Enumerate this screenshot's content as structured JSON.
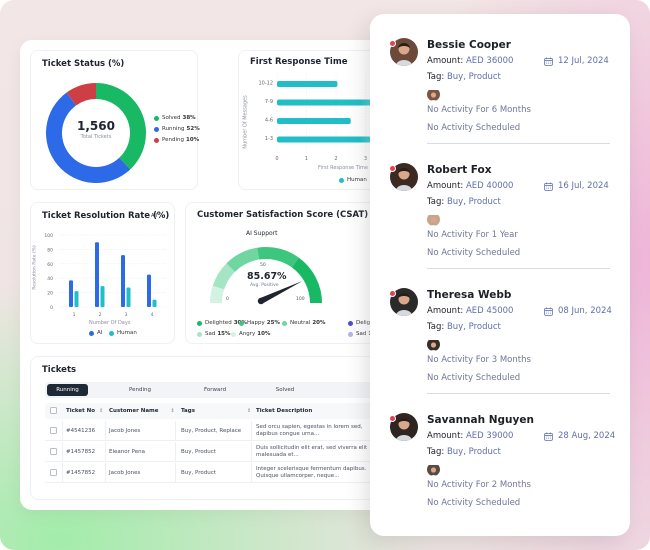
{
  "dashboard": {
    "ticket_status": {
      "title": "Ticket Status (%)",
      "total_value": "1,560",
      "total_label": "Total Tickets",
      "legend": [
        {
          "label": "Solved",
          "value": "38%",
          "color": "#18b865"
        },
        {
          "label": "Running",
          "value": "52%",
          "color": "#2c6ae8"
        },
        {
          "label": "Pending",
          "value": "10%",
          "color": "#cd3f45"
        }
      ]
    },
    "first_response": {
      "title": "First Response Time",
      "xlabel": "First Response Time",
      "ylabel": "Number Of Messages",
      "legend": "Human"
    },
    "resolution_rate": {
      "title": "Ticket Resolution Rate (%)",
      "filter": "All",
      "xlabel": "Number Of Days",
      "ylabel": "Resolution Rate (%)",
      "legend": [
        {
          "label": "AI",
          "color": "#2c6ae8"
        },
        {
          "label": "Human",
          "color": "#21bec8"
        }
      ]
    },
    "csat": {
      "title": "Customer Satisfaction Score (CSAT)",
      "gauge_title": "AI Support",
      "value": "85.67%",
      "value_label": "Avg. Positive",
      "scale_min": "0",
      "scale_mid": "50",
      "scale_max": "100",
      "needle_percent": 85.67,
      "legend": [
        {
          "label": "Delighted",
          "value": "30%",
          "color": "#18b865"
        },
        {
          "label": "Happy",
          "value": "25%",
          "color": "#3dc77e"
        },
        {
          "label": "Neutral",
          "value": "20%",
          "color": "#6fd6a0"
        },
        {
          "label": "Sad",
          "value": "15%",
          "color": "#a6e5c4"
        },
        {
          "label": "Angry",
          "value": "10%",
          "color": "#d3f3e2"
        }
      ],
      "second_legend": [
        {
          "label": "Delig",
          "color": "#4a4fd8"
        },
        {
          "label": "Sad 1",
          "color": "#b5b3ea"
        }
      ]
    },
    "tickets": {
      "title": "Tickets",
      "tabs": [
        "Running",
        "Pending",
        "Forward",
        "Solved"
      ],
      "active_tab": "Running",
      "columns": [
        "Ticket No",
        "Customer Name",
        "Tags",
        "Ticket Description"
      ],
      "rows": [
        {
          "ticket_no": "#4541236",
          "customer": "Jacob Jones",
          "tags": "Buy, Product, Replace",
          "description": "Sed orcu sapien, egestas in lorem sed, dapibus congue urna..."
        },
        {
          "ticket_no": "#1457852",
          "customer": "Eleanor Pena",
          "tags": "Buy, Product",
          "description": "Duis sollicitudin elit erat, sed viverra elit malesuada et..."
        },
        {
          "ticket_no": "#1457852",
          "customer": "Jacob Jones",
          "tags": "Buy, Product",
          "description": "Integer scelerisque fermentum dapibus. Quisque ullamcorper, neque..."
        }
      ]
    }
  },
  "leads": [
    {
      "name": "Bessie Cooper",
      "amount_label": "Amount:",
      "amount": "AED 36000",
      "date": "12 Jul, 2024",
      "tag_label": "Tag:",
      "tag": "Buy, Product",
      "activity": "No Activity For 6 Months",
      "scheduled": "No Activity Scheduled",
      "avatar_bg": "#6b4a3a",
      "mini_bg": "#7a5545"
    },
    {
      "name": "Robert Fox",
      "amount_label": "Amount:",
      "amount": "AED 40000",
      "date": "16 Jul, 2024",
      "tag_label": "Tag:",
      "tag": "Buy, Product",
      "activity": "No Activity For 1 Year",
      "scheduled": "No Activity Scheduled",
      "avatar_bg": "#3b2a22",
      "mini_bg": "#c9a48c"
    },
    {
      "name": "Theresa Webb",
      "amount_label": "Amount:",
      "amount": "AED 45000",
      "date": "08 Jun, 2024",
      "tag_label": "Tag:",
      "tag": "Buy, Product",
      "activity": "No Activity For 3 Months",
      "scheduled": "No Activity Scheduled",
      "avatar_bg": "#2a2a2a",
      "mini_bg": "#3a2c2a"
    },
    {
      "name": "Savannah Nguyen",
      "amount_label": "Amount:",
      "amount": "AED 39000",
      "date": "28 Aug, 2024",
      "tag_label": "Tag:",
      "tag": "Buy, Product",
      "activity": "No Activity For 2 Months",
      "scheduled": "No Activity Scheduled",
      "avatar_bg": "#2e2422",
      "mini_bg": "#5a4a45"
    }
  ],
  "chart_data": [
    {
      "type": "pie",
      "title": "Ticket Status (%)",
      "categories": [
        "Solved",
        "Running",
        "Pending"
      ],
      "values": [
        38,
        52,
        10
      ],
      "center_text": "1,560 Total Tickets",
      "legend_position": "right"
    },
    {
      "type": "bar",
      "orientation": "horizontal",
      "title": "First Response Time",
      "categories": [
        "10-12",
        "7-9",
        "4-6",
        "1-3"
      ],
      "series": [
        {
          "name": "Human",
          "values": [
            2.05,
            3.2,
            2.5,
            3.3
          ]
        }
      ],
      "xlabel": "First Response Time",
      "ylabel": "Number Of Messages",
      "xticks": [
        "0",
        "1",
        "2",
        "3"
      ],
      "xlim": [
        0,
        3.4
      ],
      "legend_position": "bottom",
      "grid": true
    },
    {
      "type": "bar",
      "title": "Ticket Resolution Rate (%)",
      "categories": [
        "1",
        "2",
        "3",
        "4"
      ],
      "series": [
        {
          "name": "AI",
          "values": [
            37,
            90,
            72,
            45
          ]
        },
        {
          "name": "Human",
          "values": [
            22,
            29,
            27,
            10
          ]
        }
      ],
      "xlabel": "Number Of Days",
      "ylabel": "Resolution Rate (%)",
      "yticks": [
        "0",
        "20",
        "40",
        "60",
        "80",
        "100"
      ],
      "ylim": [
        0,
        100
      ],
      "legend_position": "bottom",
      "grid": true
    },
    {
      "type": "pie",
      "subtype": "gauge",
      "title": "Customer Satisfaction Score (CSAT) - AI Support",
      "categories": [
        "Angry",
        "Sad",
        "Neutral",
        "Happy",
        "Delighted"
      ],
      "values": [
        10,
        15,
        20,
        25,
        30
      ],
      "needle_value": 85.67,
      "range": [
        0,
        100
      ],
      "legend_position": "bottom"
    }
  ]
}
